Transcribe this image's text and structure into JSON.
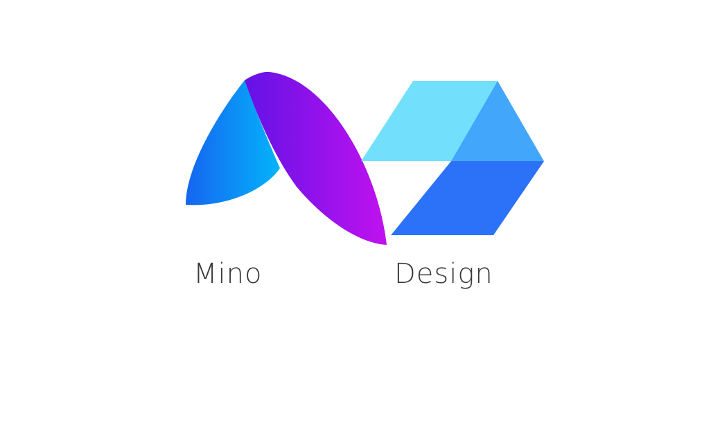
{
  "brand": {
    "words": [
      "Mino",
      "Design"
    ]
  },
  "logo": {
    "icons": [
      "leaf-m-icon",
      "hexagon-cube-icon"
    ],
    "colors": {
      "leaf_left_start": "#1565f0",
      "leaf_left_end": "#04b4fb",
      "leaf_right_start": "#6312e6",
      "leaf_right_end": "#c012ef",
      "cube_top": "#72e0fc",
      "cube_right": "#42a6fb",
      "cube_bottom": "#2b72f8"
    }
  }
}
